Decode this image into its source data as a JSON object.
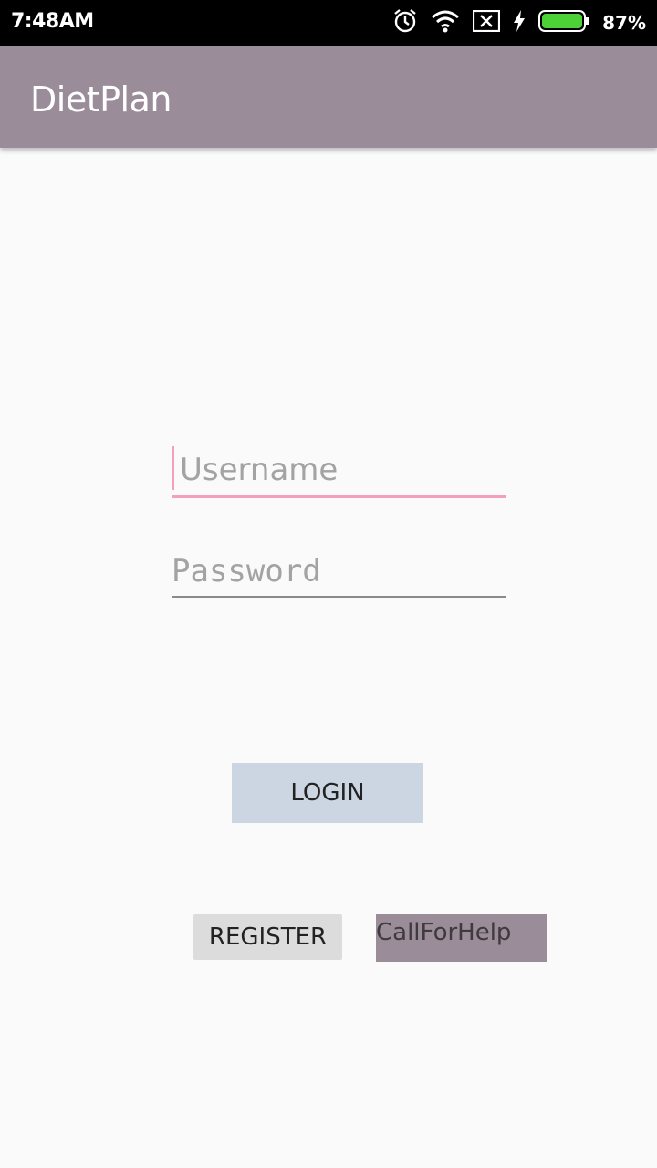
{
  "status_bar": {
    "time": "7:48AM",
    "battery_percent": "87%",
    "icons": [
      "alarm-icon",
      "wifi-icon",
      "no-sim-icon",
      "charging-icon",
      "battery-icon"
    ],
    "battery_level": 0.87,
    "battery_color": "#4cd137"
  },
  "app_bar": {
    "title": "DietPlan",
    "color": "#9a8c98"
  },
  "login_form": {
    "username_placeholder": "Username",
    "password_placeholder": "Password",
    "accent_color": "#f2a1b8",
    "login_label": "LOGIN",
    "register_label": "REGISTER",
    "help_label": "CallForHelp"
  }
}
